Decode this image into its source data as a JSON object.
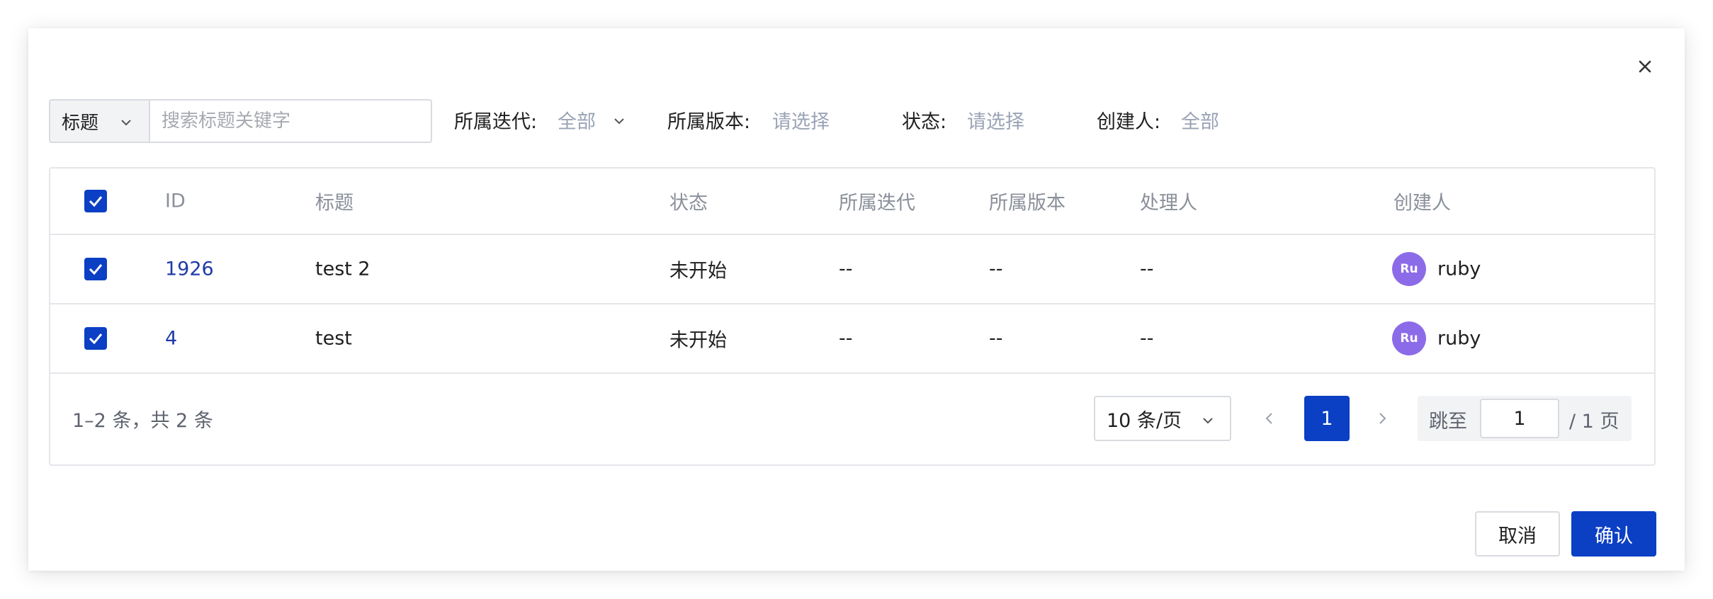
{
  "filters": {
    "type_label": "标题",
    "search_placeholder": "搜索标题关键字",
    "iteration_label": "所属迭代:",
    "iteration_value": "全部",
    "version_label": "所属版本:",
    "version_value": "请选择",
    "status_label": "状态:",
    "status_value": "请选择",
    "creator_label": "创建人:",
    "creator_value": "全部"
  },
  "table": {
    "columns": [
      "ID",
      "标题",
      "状态",
      "所属迭代",
      "所属版本",
      "处理人",
      "创建人"
    ],
    "rows": [
      {
        "id": "1926",
        "title": "test 2",
        "status": "未开始",
        "iteration": "--",
        "version": "--",
        "assignee": "--",
        "creator_initials": "Ru",
        "creator": "ruby"
      },
      {
        "id": "4",
        "title": "test",
        "status": "未开始",
        "iteration": "--",
        "version": "--",
        "assignee": "--",
        "creator_initials": "Ru",
        "creator": "ruby"
      }
    ]
  },
  "pagination": {
    "total_text": "1–2 条，共 2 条",
    "page_size": "10 条/页",
    "current_page": "1",
    "jump_label": "跳至",
    "jump_value": "1",
    "total_pages_text": "/ 1 页"
  },
  "actions": {
    "cancel": "取消",
    "confirm": "确认"
  },
  "colors": {
    "primary": "#0b3fc4",
    "link": "#1e3ba8",
    "avatar": "#8c6be8",
    "placeholder": "#9aa3b5"
  }
}
